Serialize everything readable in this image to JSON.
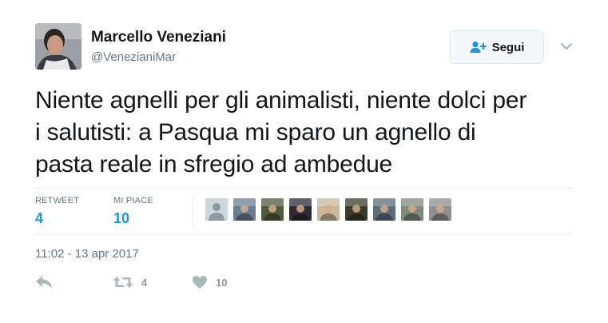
{
  "author": {
    "name": "Marcello Veneziani",
    "handle": "@VenezianiMar"
  },
  "follow_button": {
    "label": "Segui",
    "icon": "add-user-icon"
  },
  "tweet": {
    "text_lines": [
      "Niente agnelli per gli animalisti, niente dolci per",
      "i salutisti: a Pasqua mi sparo un agnello di",
      "pasta reale in sfregio ad ambedue"
    ]
  },
  "stats": {
    "retweets": {
      "label": "RETWEET",
      "value": "4"
    },
    "likes": {
      "label": "MI PIACE",
      "value": "10"
    }
  },
  "likers": [
    {
      "icon": "default-avatar-icon",
      "color": "#aab8c2"
    },
    {
      "icon": "avatar-photo",
      "color": "#6a7d95"
    },
    {
      "icon": "avatar-photo",
      "color": "#4f5a3a"
    },
    {
      "icon": "avatar-photo",
      "color": "#2f2a33"
    },
    {
      "icon": "avatar-photo",
      "color": "#c9b89a"
    },
    {
      "icon": "avatar-photo",
      "color": "#3b3b2c"
    },
    {
      "icon": "avatar-photo",
      "color": "#5b6e7a"
    },
    {
      "icon": "avatar-photo",
      "color": "#7c8a7a"
    },
    {
      "icon": "avatar-photo",
      "color": "#8f8f8f"
    }
  ],
  "timestamp": "11:02 - 13 apr 2017",
  "actions": {
    "reply": {
      "icon": "reply-icon"
    },
    "retweet": {
      "icon": "retweet-icon",
      "count": "4"
    },
    "like": {
      "icon": "heart-icon",
      "count": "10"
    }
  },
  "colors": {
    "text": "#14171a",
    "secondary": "#657786",
    "link": "#1b95e0",
    "action_gray": "#8899a6",
    "border": "#e6ecf0"
  }
}
